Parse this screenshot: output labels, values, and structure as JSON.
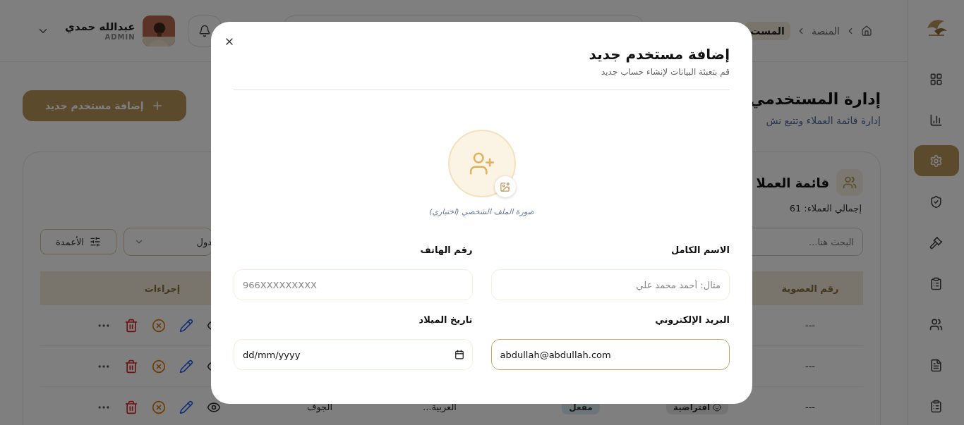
{
  "sidebar": {
    "items": [
      {
        "selected": false
      },
      {
        "selected": false
      },
      {
        "selected": true
      },
      {
        "selected": false
      },
      {
        "selected": false
      },
      {
        "selected": false
      },
      {
        "selected": false
      },
      {
        "selected": false
      },
      {
        "selected": false
      }
    ]
  },
  "header": {
    "breadcrumbs": [
      {
        "label": "المنصة",
        "selected": false
      },
      {
        "label": "المست",
        "selected": true
      }
    ],
    "user": {
      "name": "عبدالله حمدي",
      "role": "ADMIN"
    }
  },
  "page": {
    "title": "إدارة المستخدمي",
    "subtitle": "إدارة قائمة العملاء وتتبع نش",
    "add_button": "إضافة مستخدم جديد"
  },
  "card": {
    "title": "قائمة العملا",
    "count": "إجمالي العملاء: 61",
    "search": {
      "placeholder": "البحث هنا..."
    },
    "view_select": "دول",
    "columns_button": "الأعمدة",
    "table": {
      "columns": [
        "رقم العضوية",
        "",
        "",
        "",
        "",
        "إجراءات"
      ],
      "rows": [
        {
          "membership": "---"
        },
        {
          "membership": "---"
        },
        {
          "membership": "---",
          "type": "افتراضية",
          "status": "مفعل",
          "country": "العربية...",
          "city": "الجوف"
        }
      ]
    }
  },
  "modal": {
    "title": "إضافة مستخدم جديد",
    "subtitle": "قم بتعبئة البيانات لإنشاء حساب جديد",
    "photo_caption": "صورة الملف الشخصي (اختياري)",
    "fields": [
      {
        "label": "الاسم الكامل",
        "placeholder": "مثال: أحمد محمد علي",
        "focused": false,
        "kind": "text"
      },
      {
        "label": "رقم الهاتف",
        "placeholder": "966XXXXXXXXX",
        "focused": false,
        "kind": "text"
      },
      {
        "label": "البريد الإلكتروني",
        "value": "abdullah@abdullah.com",
        "focused": true,
        "kind": "text"
      },
      {
        "label": "تاريخ الميلاد",
        "placeholder": "dd/mm/yyyy",
        "focused": false,
        "kind": "date"
      }
    ]
  }
}
